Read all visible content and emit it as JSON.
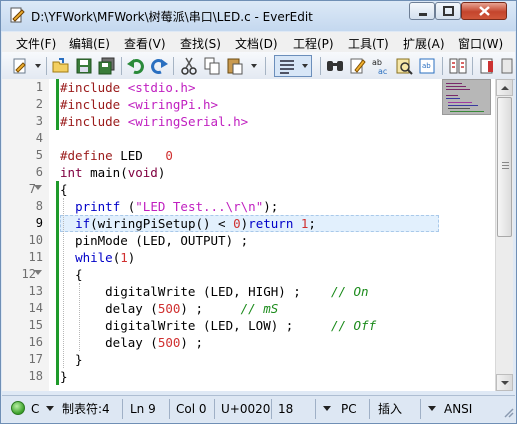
{
  "window": {
    "title": "D:\\YFWork\\MFWork\\树莓派\\串口\\LED.c - EverEdit"
  },
  "menu": [
    "文件(F)",
    "编辑(E)",
    "查看(V)",
    "查找(S)",
    "文档(D)",
    "工程(P)",
    "工具(T)",
    "扩展(A)",
    "窗口(W)"
  ],
  "toolbar": {
    "icons": [
      "new-file-icon",
      "open-folder-icon",
      "save-icon",
      "save-all-icon",
      "undo-icon",
      "redo-icon",
      "cut-icon",
      "copy-icon",
      "paste-icon",
      "word-wrap-icon",
      "find-icon",
      "find-in-files-icon",
      "replace-icon",
      "find-file-icon",
      "column-mode-icon",
      "bookmark-icon"
    ]
  },
  "editor": {
    "current_line": 9,
    "lines": [
      {
        "n": "1",
        "text": "#include <stdio.h>"
      },
      {
        "n": "2",
        "text": "#include <wiringPi.h>"
      },
      {
        "n": "3",
        "text": "#include <wiringSerial.h>"
      },
      {
        "n": "4",
        "text": ""
      },
      {
        "n": "5",
        "text": "#define LED   0"
      },
      {
        "n": "6",
        "text": "int main(void)"
      },
      {
        "n": "7",
        "text": "{"
      },
      {
        "n": "8",
        "text": "  printf (\"LED Test...\\r\\n\");"
      },
      {
        "n": "9",
        "text": "  if(wiringPiSetup() < 0)return 1;"
      },
      {
        "n": "10",
        "text": "  pinMode (LED, OUTPUT) ;"
      },
      {
        "n": "11",
        "text": "  while(1)"
      },
      {
        "n": "12",
        "text": "  {"
      },
      {
        "n": "13",
        "text": "      digitalWrite (LED, HIGH) ;    // On"
      },
      {
        "n": "14",
        "text": "      delay (500) ;     // mS"
      },
      {
        "n": "15",
        "text": "      digitalWrite (LED, LOW) ;     // Off"
      },
      {
        "n": "16",
        "text": "      delay (500) ;"
      },
      {
        "n": "17",
        "text": "  }"
      },
      {
        "n": "18",
        "text": "}"
      }
    ]
  },
  "status": {
    "c_label": "C",
    "tab": "制表符:4",
    "line": "Ln 9",
    "col": "Col 0",
    "char": "U+0020",
    "size": "18",
    "eol": "PC",
    "mode": "插入",
    "encoding": "ANSI"
  },
  "colors": {
    "keyword": "#0000c8",
    "string": "#c020c0",
    "comment": "#1a8a1a",
    "number": "#d03030",
    "accent": "#6f8fb5"
  }
}
